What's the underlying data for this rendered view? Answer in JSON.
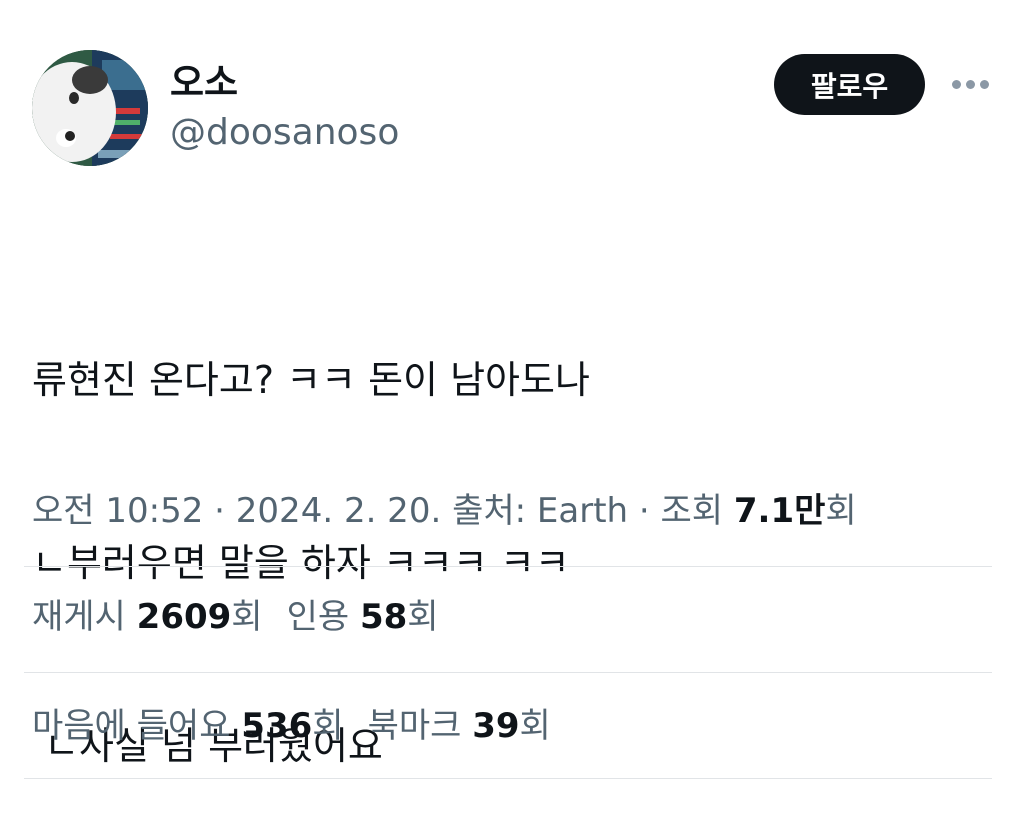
{
  "author": {
    "display_name": "오소",
    "handle": "@doosanoso",
    "avatar_icon": "panda-avatar"
  },
  "header": {
    "follow_label": "팔로우",
    "more_icon": "more-horizontal-icon"
  },
  "tweet": {
    "lines": [
      "류현진 온다고? ㅋㅋ 돈이 남아도나",
      "ㄴ부러우면 말을 하자 ㅋㅋㅋ ㅋㅋ",
      " ㄴ사실 넘 부러웠어요"
    ]
  },
  "meta": {
    "time": "오전 10:52",
    "separator": " · ",
    "date": "2024. 2. 20.",
    "source_label": "출처: Earth",
    "views_prefix": "조회 ",
    "views_count": "7.1만",
    "views_suffix": "회"
  },
  "stats": {
    "reposts_label": "재게시 ",
    "reposts_count": "2609",
    "reposts_suffix": "회",
    "quotes_label": "인용 ",
    "quotes_count": "58",
    "quotes_suffix": "회",
    "likes_label": "마음에 들어요 ",
    "likes_count": "536",
    "likes_suffix": "회",
    "bookmarks_label": "북마크 ",
    "bookmarks_count": "39",
    "bookmarks_suffix": "회"
  },
  "colors": {
    "text_primary": "#0f1419",
    "text_secondary": "#536471",
    "divider": "#e1e4e7",
    "follow_bg": "#0f1419"
  }
}
